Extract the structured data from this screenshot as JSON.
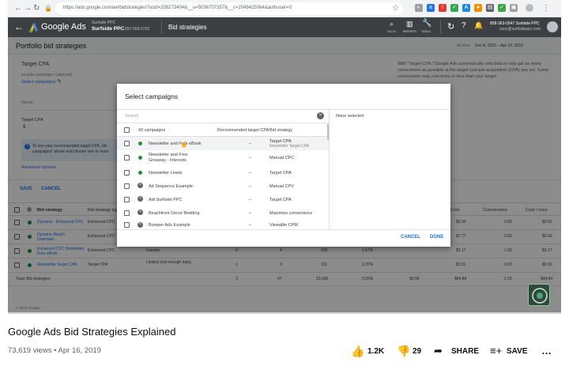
{
  "browser": {
    "url": "https://ads.google.com/aw/bidstrategies?ocid=208273404&__u=5036707357&__c=2049425064&authuser=0"
  },
  "header": {
    "product": "Google Ads",
    "account_label": "Surfside PPC",
    "account_name": "Surfside PPC",
    "account_id": "697-059-0703",
    "section": "Bid strategies",
    "tools": [
      "GO TO",
      "REPORTS",
      "TOOLS"
    ],
    "phone": "858-363-0547 Surfside PPC",
    "email": "conv@surfsideppc.com"
  },
  "page": {
    "title": "Portfolio bid strategies",
    "date_prefix": "All time",
    "date_range": "Dec 8, 2016 – Apr 16, 2019",
    "strategy_type": "Target CPA",
    "include_label": "Include campaigns (optional)",
    "select_campaigns_link": "Select campaigns",
    "name_label": "Name",
    "target_cpa_label": "Target CPA",
    "currency": "$",
    "hint_text_1": "To see your recommended target CPA, clic",
    "hint_text_2": "campaigns\" above and choose one or more",
    "advanced_options": "Advanced options",
    "description": "With \"Target CPA,\" Google Ads automatically sets bids to help get as many conversions as possible at the target cost-per-acquisition (CPA) you set. Some conversions may cost more or less than your target.",
    "save": "SAVE",
    "cancel": "CANCEL",
    "table_headers": [
      "Bid strategy",
      "Bid strategy type",
      "",
      "",
      "",
      "",
      "",
      "Cost",
      "Conversions",
      "Cost / conv."
    ],
    "rows": [
      {
        "name": "Dynamic - Enhanced CPC",
        "type": "Enhanced CPC",
        "status": "",
        "c1": "",
        "c2": "",
        "c3": "",
        "c4": "",
        "cost": "$0.00",
        "conv": "0.00",
        "cpc": "$0.00"
      },
      {
        "name": "Dynamic Beach Doormats",
        "type": "Enhanced CPC",
        "status": "",
        "c1": "",
        "c2": "",
        "c3": "",
        "c4": "",
        "cost": "$7.77",
        "conv": "0.00",
        "cpc": "$0.00"
      },
      {
        "name": "Enhanced CPC Newsletter Free eBook",
        "type": "Enhanced CPC",
        "status": "Inactive",
        "c1": "0",
        "c2": "4",
        "c3": "239",
        "c4": "1.67%",
        "cost": "$3.17",
        "conv": "1.00",
        "cpc": "$3.17"
      },
      {
        "name": "Newsletter Target CPA",
        "type": "Target CPA",
        "status": "Limited (not enough data)",
        "c1": "1",
        "c2": "3",
        "c3": "101",
        "c4": "2.97%",
        "cost": "$3.91",
        "conv": "0.00",
        "cpc": "$0.00"
      }
    ],
    "total_row": {
      "name": "Total: Bid strategies",
      "c1": "3",
      "c2": "47",
      "c3": "23,699",
      "c4": "0.20%",
      "c5": "$0.95",
      "cost": "$44.84",
      "conv": "1.00",
      "cpc": "$44.84"
    },
    "footer": "© 2019 Google"
  },
  "dialog": {
    "title": "Select campaigns",
    "search_placeholder": "Search",
    "none_selected": "None selected",
    "col_campaigns": "43 campaigns",
    "col_target": "Recommended target CPA",
    "col_strategy": "Bid strategy",
    "campaigns": [
      {
        "name": "Newsletter and Free eBook",
        "target": "–",
        "strategy": "Target CPA",
        "sub": "Newsletter Target CPA",
        "status": "green"
      },
      {
        "name": "Newsletter and Free Greaway - Interests",
        "target": "–",
        "strategy": "Manual CPC",
        "sub": "",
        "status": "green"
      },
      {
        "name": "Newsletter Leads",
        "target": "–",
        "strategy": "Target CPA",
        "sub": "",
        "status": "green"
      },
      {
        "name": "Ad Sequence Example",
        "target": "–",
        "strategy": "Manual CPV",
        "sub": "",
        "status": "grey"
      },
      {
        "name": "Adi Surfside PPC",
        "target": "–",
        "strategy": "Target CPA",
        "sub": "",
        "status": "grey"
      },
      {
        "name": "Beachfront Decor Bedding",
        "target": "–",
        "strategy": "Maximize conversions",
        "sub": "",
        "status": "grey"
      },
      {
        "name": "Bumper Ads Example",
        "target": "–",
        "strategy": "Viewable CPM",
        "sub": "",
        "status": "grey"
      }
    ],
    "cancel": "CANCEL",
    "done": "DONE"
  },
  "video": {
    "title": "Google Ads Bid Strategies Explained",
    "views": "73,619 views",
    "date": "Apr 16, 2019",
    "likes": "1.2K",
    "dislikes": "29",
    "share": "SHARE",
    "save": "SAVE"
  },
  "colors": {
    "blue": "#1a73e8",
    "green": "#1e8e3e",
    "header": "#3c4043"
  }
}
